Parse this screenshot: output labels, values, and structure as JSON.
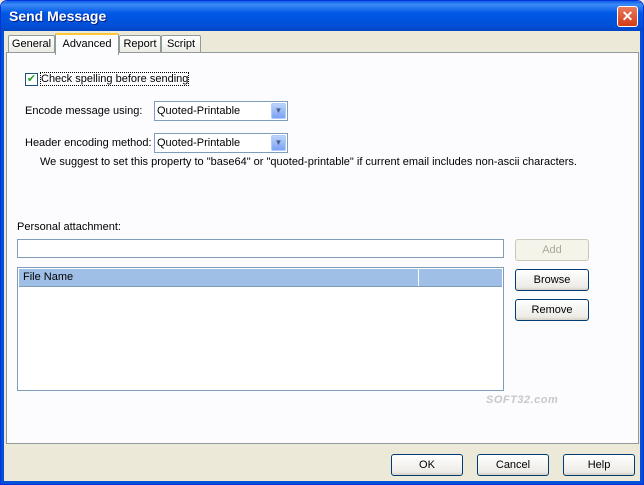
{
  "window": {
    "title": "Send Message",
    "close_glyph": "✕"
  },
  "tabs": [
    {
      "label": "General"
    },
    {
      "label": "Advanced"
    },
    {
      "label": "Report"
    },
    {
      "label": "Script"
    }
  ],
  "active_tab": "Advanced",
  "advanced": {
    "spellcheck_label": "Check spelling before sending",
    "spellcheck_checked": true,
    "check_glyph": "✔",
    "encode_label": "Encode message using:",
    "encode_value": "Quoted-Printable",
    "header_label": "Header encoding method:",
    "header_value": "Quoted-Printable",
    "hint": "We suggest to set this property to \"base64\" or \"quoted-printable\"  if current email includes non-ascii characters.",
    "dropdown_glyph": "▼"
  },
  "attachment": {
    "label": "Personal attachment:",
    "path_value": "",
    "column_file_name": "File Name",
    "add_label": "Add",
    "browse_label": "Browse",
    "remove_label": "Remove"
  },
  "footer": {
    "ok_label": "OK",
    "cancel_label": "Cancel",
    "help_label": "Help"
  },
  "watermark": "SOFT32.com",
  "colors": {
    "titlebar": "#0058e6",
    "tab_highlight": "#ffc83c",
    "listview_header": "#9fbfe6"
  }
}
